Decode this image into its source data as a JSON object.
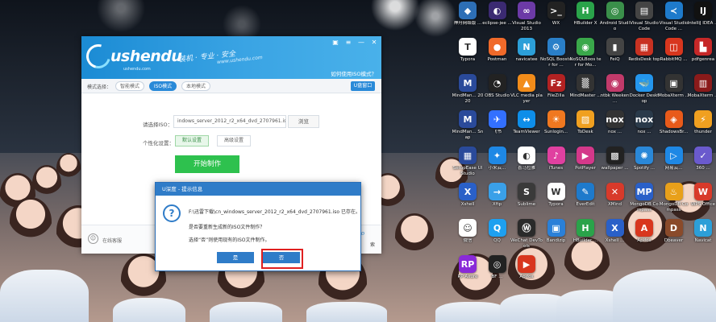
{
  "desktop": {
    "icons": [
      {
        "label": "神舟网络版 ...",
        "icon": "hp-icon",
        "color": "#2d6fb6",
        "glyph": "◆"
      },
      {
        "label": "eclipse-jee ...",
        "icon": "eclipse-icon",
        "color": "#3b2a72",
        "glyph": "◐"
      },
      {
        "label": "Visual Studio 2013",
        "icon": "visual-studio-icon",
        "color": "#6c3aa6",
        "glyph": "∞"
      },
      {
        "label": "WX",
        "icon": "wx-icon",
        "color": "#222222",
        "glyph": ">_"
      },
      {
        "label": "HBuilder X",
        "icon": "hbuilder-icon",
        "color": "#2aa34a",
        "glyph": "H"
      },
      {
        "label": "Android Studio",
        "icon": "android-studio-icon",
        "color": "#3a8f4a",
        "glyph": "◎"
      },
      {
        "label": "Visual Studio Code",
        "icon": "vscode-icon",
        "color": "#444444",
        "glyph": "▤"
      },
      {
        "label": "Visual Studio Code ...",
        "icon": "vscode-icon",
        "color": "#1e7acb",
        "glyph": "≺"
      },
      {
        "label": "IntelliJ IDEA ...",
        "icon": "intellij-icon",
        "color": "#111111",
        "glyph": "IJ"
      },
      {
        "label": "Typora",
        "icon": "typora-icon",
        "color": "#ffffff",
        "glyph": "T"
      },
      {
        "label": "Postman",
        "icon": "postman-icon",
        "color": "#f06a2a",
        "glyph": "●"
      },
      {
        "label": "navicatee",
        "icon": "navicat-icon",
        "color": "#2c9fd8",
        "glyph": "N"
      },
      {
        "label": "NoSQL Booster for ...",
        "icon": "nosqlbooster-icon",
        "color": "#2a7fc8",
        "glyph": "⚙"
      },
      {
        "label": "NoSQLBoos ter for Mo...",
        "icon": "nosqlbooster-icon",
        "color": "#3aa84a",
        "glyph": "◉"
      },
      {
        "label": "FeiQ",
        "icon": "feiq-icon",
        "color": "#444444",
        "glyph": "▮"
      },
      {
        "label": "RedisDesk top",
        "icon": "redis-icon",
        "color": "#c83222",
        "glyph": "▦"
      },
      {
        "label": "RabbitMQ ...",
        "icon": "rabbitmq-icon",
        "color": "#d8361e",
        "glyph": "◫"
      },
      {
        "label": "pdfgenrea",
        "icon": "pdf-icon",
        "color": "#c62828",
        "glyph": "▙"
      },
      {
        "label": "MindMan... 2020",
        "icon": "mindmanager-icon",
        "color": "#2a4a9a",
        "glyph": "M"
      },
      {
        "label": "OBS Studio",
        "icon": "obs-icon",
        "color": "#222222",
        "glyph": "◔"
      },
      {
        "label": "VLC media player",
        "icon": "vlc-icon",
        "color": "#f28c1a",
        "glyph": "▲"
      },
      {
        "label": "FileZilla",
        "icon": "filezilla-icon",
        "color": "#b22222",
        "glyph": "Fz"
      },
      {
        "label": "MindMaster ...",
        "icon": "mindmaster-icon",
        "color": "#333333",
        "glyph": "▒"
      },
      {
        "label": "ntbk Weeken ...",
        "icon": "ntbk-icon",
        "color": "#c23a6a",
        "glyph": "◉"
      },
      {
        "label": "Docker Desktop",
        "icon": "docker-icon",
        "color": "#2496ed",
        "glyph": "🐳"
      },
      {
        "label": "MobaXterm ...",
        "icon": "mobaxterm-icon",
        "color": "#333333",
        "glyph": "▣"
      },
      {
        "label": "MobaXterm ...",
        "icon": "mobaxterm-icon",
        "color": "#8a1a1a",
        "glyph": "▥"
      },
      {
        "label": "MindMan... Snap",
        "icon": "mindmanager-icon",
        "color": "#2a4a9a",
        "glyph": "M"
      },
      {
        "label": "飞书",
        "icon": "feishu-icon",
        "color": "#3370ff",
        "glyph": "✈"
      },
      {
        "label": "TeamViewer",
        "icon": "teamviewer-icon",
        "color": "#0e8ee9",
        "glyph": "↔"
      },
      {
        "label": "Sunlogin...",
        "icon": "sunlogin-icon",
        "color": "#f07820",
        "glyph": "☀"
      },
      {
        "label": "ToDesk",
        "icon": "todesk-icon",
        "color": "#f0a020",
        "glyph": "▨"
      },
      {
        "label": "nox ...",
        "icon": "nox-icon",
        "color": "#333333",
        "glyph": "nox"
      },
      {
        "label": "nox ...",
        "icon": "nox-icon",
        "color": "#2a3a4a",
        "glyph": "nox"
      },
      {
        "label": "ShadowsBr...",
        "icon": "shadowsbr-icon",
        "color": "#e85a1a",
        "glyph": "◈"
      },
      {
        "label": "thunder",
        "icon": "thunder-icon",
        "color": "#f0a020",
        "glyph": "⚡"
      },
      {
        "label": "SetupEase UI Studio",
        "icon": "setup-icon",
        "color": "#2a4a9a",
        "glyph": "▦"
      },
      {
        "label": "小米云...",
        "icon": "mi-icon",
        "color": "#1e88e5",
        "glyph": "✦"
      },
      {
        "label": "喜马拉雅",
        "icon": "ximalaya-icon",
        "color": "#ffffff",
        "glyph": "◐"
      },
      {
        "label": "iTunes",
        "icon": "itunes-icon",
        "color": "#e040a0",
        "glyph": "♪"
      },
      {
        "label": "PotPlayer",
        "icon": "potplayer-icon",
        "color": "#d4388a",
        "glyph": "▶"
      },
      {
        "label": "wallpaper ...",
        "icon": "wallpaper-icon",
        "color": "#222222",
        "glyph": "▩"
      },
      {
        "label": "Spotify ...",
        "icon": "spotify-icon",
        "color": "#2a88d8",
        "glyph": "✺"
      },
      {
        "label": "网易云...",
        "icon": "netease-icon",
        "color": "#1e88e5",
        "glyph": "▷"
      },
      {
        "label": "360 ...",
        "icon": "safe-icon",
        "color": "#6a5acd",
        "glyph": "✓"
      },
      {
        "label": "Xshell",
        "icon": "xshell-icon",
        "color": "#2a60c8",
        "glyph": "X"
      },
      {
        "label": "Xftp",
        "icon": "xftp-icon",
        "color": "#3aa0e8",
        "glyph": "→"
      },
      {
        "label": "Sublime",
        "icon": "sublime-icon",
        "color": "#3a3a3a",
        "glyph": "S"
      },
      {
        "label": "Typora",
        "icon": "typora-icon",
        "color": "#ffffff",
        "glyph": "W"
      },
      {
        "label": "EverEdit",
        "icon": "everedit-icon",
        "color": "#1e7acb",
        "glyph": "✎"
      },
      {
        "label": "XMind",
        "icon": "xmind-icon",
        "color": "#d83a2a",
        "glyph": "✕"
      },
      {
        "label": "MongoDB Compass",
        "icon": "mpc-icon",
        "color": "#2a60c8",
        "glyph": "MP"
      },
      {
        "label": "MongoDB Compass",
        "icon": "mongodb-icon",
        "color": "#e8a01a",
        "glyph": "♨"
      },
      {
        "label": "WPS Office",
        "icon": "wps-icon",
        "color": "#d83a2a",
        "glyph": "W"
      },
      {
        "label": "微信",
        "icon": "wechat-icon",
        "color": "#ffffff",
        "glyph": "☺"
      },
      {
        "label": "QQ",
        "icon": "qq-icon",
        "color": "#1ea0f0",
        "glyph": "Q"
      },
      {
        "label": "WeChat DevTools",
        "icon": "devtools-icon",
        "color": "#2a2a2a",
        "glyph": "Ⓦ"
      },
      {
        "label": "Bandizip",
        "icon": "bandizip-icon",
        "color": "#2a80d8",
        "glyph": "▣"
      },
      {
        "label": "HBuilder ...",
        "icon": "hbuilder-icon",
        "color": "#2aa34a",
        "glyph": "H"
      },
      {
        "label": "Xshell ...",
        "icon": "xshell-icon",
        "color": "#2a60c8",
        "glyph": "X"
      },
      {
        "label": "Apifox",
        "icon": "apifox-icon",
        "color": "#d8361e",
        "glyph": "A"
      },
      {
        "label": "Dbeaver",
        "icon": "dbeaver-icon",
        "color": "#8a4a2a",
        "glyph": "D"
      },
      {
        "label": "Navicat",
        "icon": "navicat-icon",
        "color": "#2c9fd8",
        "glyph": "N"
      },
      {
        "label": "RP Axure",
        "icon": "rp-icon",
        "color": "#8a2ad8",
        "glyph": "RP"
      },
      {
        "label": "BF ...",
        "icon": "bf-icon",
        "color": "#222222",
        "glyph": "◎"
      },
      {
        "label": "Apifox",
        "icon": "apifox-icon",
        "color": "#d8361e",
        "glyph": "▶"
      }
    ]
  },
  "app": {
    "brand": "ushendu",
    "brand_sub": "ushendu.com",
    "slogan": "装机 · 专业 · 安全",
    "slogan_url": "www.ushendu.com",
    "help_link": "如何使用ISO模式？",
    "mode_label": "模式选择：",
    "modes": [
      "智能模式",
      "ISO模式",
      "本地模式"
    ],
    "usb_window_btn": "U盘窗口",
    "iso_label": "请选择ISO：",
    "iso_value": "indows_server_2012_r2_x64_dvd_2707961.iso",
    "browse": "浏览",
    "personal_label": "个性化设置：",
    "set_default": "默认设置",
    "set_advanced": "高级设置",
    "start": "开始制作",
    "customer_service": "在线客服",
    "search_text": "索"
  },
  "dialog": {
    "title": "U深度 - 提示信息",
    "line1": "F:\\迅雷下载\\cn_windows_server_2012_r2_x64_dvd_2707961.iso 已存在。",
    "line2": "是否要重新生成新的ISO文件制作？",
    "line3": "选择“否”则使用现有的ISO文件制作。",
    "yes": "是",
    "no": "否"
  }
}
